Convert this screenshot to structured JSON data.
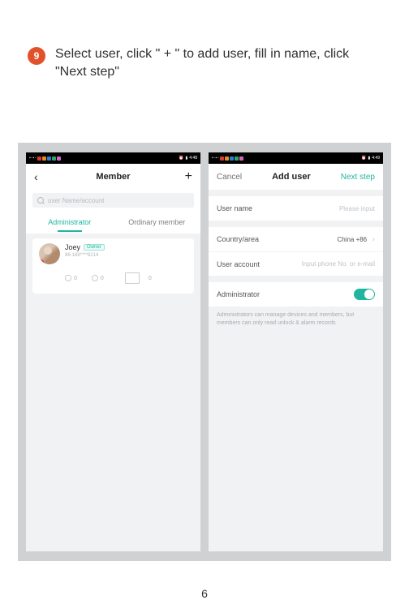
{
  "step": {
    "number": "9",
    "text": "Select user, click \" + \" to add user, fill in name, click \"Next step\""
  },
  "statusbar": {
    "time1": "4:48",
    "time2": "4:49"
  },
  "phone1": {
    "title": "Member",
    "search_placeholder": "user Name/account",
    "tab_admin": "Administrator",
    "tab_ordinary": "Ordinary member",
    "member": {
      "name": "Joey",
      "owner": "Owner",
      "sub": "86-188****8214",
      "fp": "0",
      "pw": "0",
      "card": "0"
    }
  },
  "phone2": {
    "cancel": "Cancel",
    "title": "Add user",
    "next": "Next step",
    "row_user_name_label": "User name",
    "row_user_name_value": "Please input",
    "row_country_label": "Country/area",
    "row_country_value": "China +86",
    "row_account_label": "User account",
    "row_account_value": "Input phone No. or e-mail",
    "row_admin_label": "Administrator",
    "note": "Administrators can manage devices and members, but members can only read unlock & alarm records"
  },
  "page_number": "6"
}
